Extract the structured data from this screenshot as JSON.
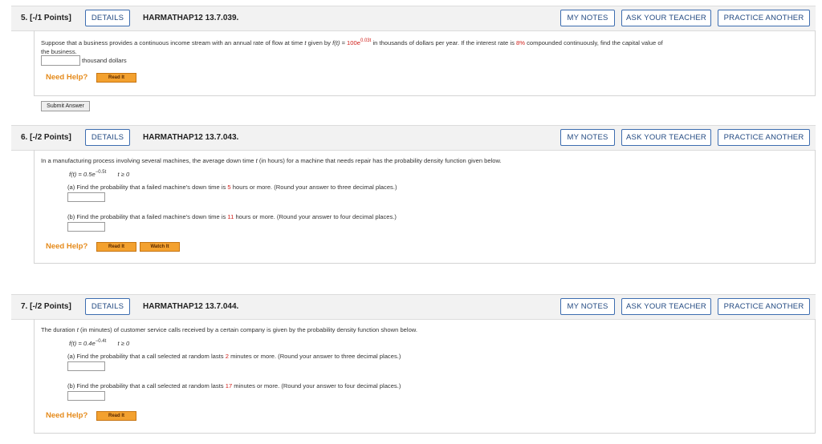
{
  "buttons": {
    "details": "DETAILS",
    "my_notes": "MY NOTES",
    "ask_teacher": "ASK YOUR TEACHER",
    "practice_another": "PRACTICE ANOTHER",
    "read_it": "Read It",
    "watch_it": "Watch It",
    "submit_answer": "Submit Answer"
  },
  "need_help": "Need Help?",
  "q5": {
    "number": "5.",
    "points": "[-/1 Points]",
    "id": "HARMATHAP12 13.7.039.",
    "text_a": "Suppose that a business provides a continuous income stream with an annual rate of flow at time",
    "var_t": "t",
    "text_b": "given by",
    "fn": "f(t) =",
    "fn_base": "100e",
    "fn_exp": "0.03t",
    "text_c": "in thousands of dollars per year. If the interest rate is",
    "rate": "8%",
    "text_d": "compounded continuously, find the capital value of",
    "text_e": "the business.",
    "unit": "thousand dollars"
  },
  "q6": {
    "number": "6.",
    "points": "[-/2 Points]",
    "id": "HARMATHAP12 13.7.043.",
    "intro_a": "In a manufacturing process involving several machines, the average down time",
    "intro_var": "t",
    "intro_b": "(in hours) for a machine that needs repair has the probability density function given below.",
    "fn": "f(t) = 0.5e",
    "fn_exp": "−0.5t",
    "cond": "t ≥ 0",
    "a_text_1": "(a) Find the probability that a failed machine's down time is",
    "a_value": "5",
    "a_text_2": "hours or more. (Round your answer to three decimal places.)",
    "b_text_1": "(b) Find the probability that a failed machine's down time is",
    "b_value": "11",
    "b_text_2": "hours or more. (Round your answer to four decimal places.)"
  },
  "q7": {
    "number": "7.",
    "points": "[-/2 Points]",
    "id": "HARMATHAP12 13.7.044.",
    "intro_a": "The duration",
    "intro_var": "t",
    "intro_b": "(in minutes) of customer service calls received by a certain company is given by the probability density function shown below.",
    "fn": "f(t) = 0.4e",
    "fn_exp": "−0.4t",
    "cond": "t ≥ 0",
    "a_text_1": "(a) Find the probability that a call selected at random lasts",
    "a_value": "2",
    "a_text_2": "minutes or more. (Round your answer to three decimal places.)",
    "b_text_1": "(b) Find the probability that a call selected at random lasts",
    "b_value": "17",
    "b_text_2": "minutes or more. (Round your answer to four decimal places.)"
  }
}
